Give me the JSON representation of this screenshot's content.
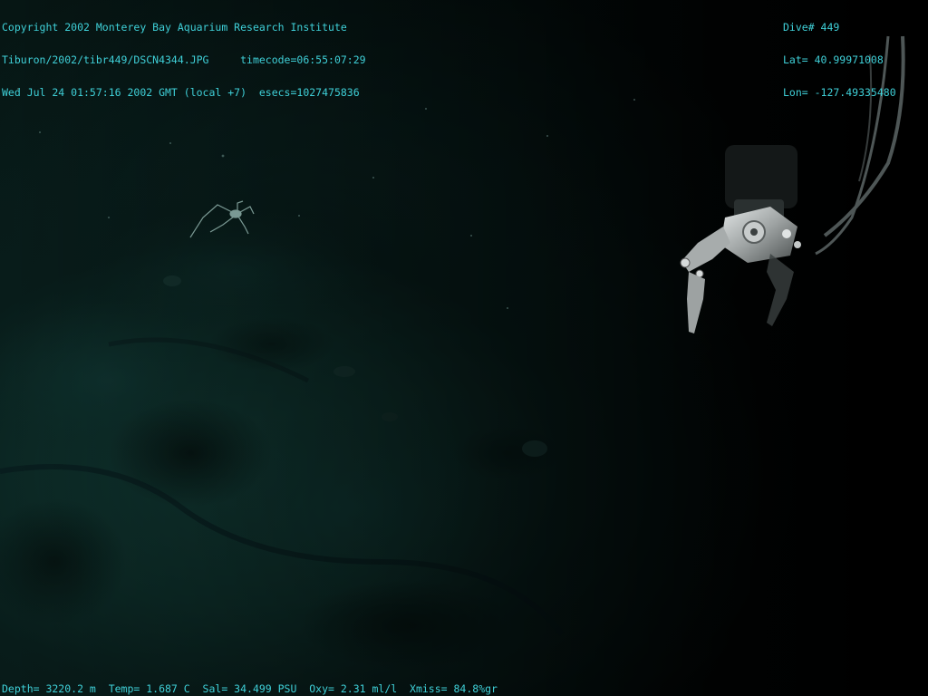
{
  "overlay": {
    "top_left": [
      "Copyright 2002 Monterey Bay Aquarium Research Institute",
      "Tiburon/2002/tibr449/DSCN4344.JPG     timecode=06:55:07:29",
      "Wed Jul 24 01:57:16 2002 GMT (local +7)  esecs=1027475836"
    ],
    "top_right": [
      "Dive# 449",
      "Lat= 40.99971008",
      "Lon= -127.49335480"
    ],
    "bottom": "Depth= 3220.2 m  Temp= 1.687 C  Sal= 34.499 PSU  Oxy= 2.31 ml/l  Xmiss= 84.8%gr"
  },
  "colors": {
    "overlay_text": "#3fd0d8",
    "seafloor": "#0c2a26",
    "water": "#000000",
    "manipulator_metal": "#b8bcbc"
  },
  "scene_objects": [
    "seafloor-sediment",
    "sea-spider",
    "robotic-manipulator-arm",
    "tether-cables"
  ]
}
